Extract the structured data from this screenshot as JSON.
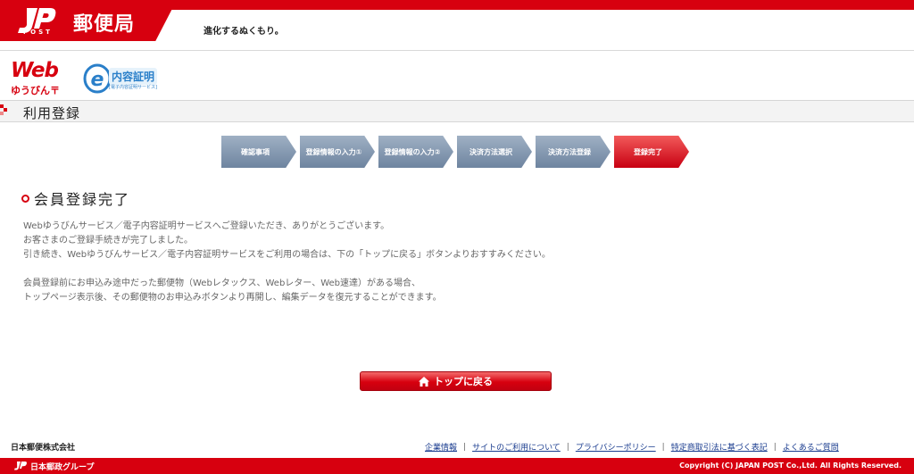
{
  "header": {
    "brand_post": "POST",
    "brand_name": "郵便局",
    "slogan": "進化するぬくもり。",
    "brand_color": "#d7000f"
  },
  "services": {
    "web_word": "Web",
    "web_sub": "ゆうびん〒",
    "e_content": "内容証明",
    "e_sub": "[電子内容証明サービス]"
  },
  "page_title": "利用登録",
  "steps": [
    {
      "label": "確認事項",
      "active": false
    },
    {
      "label": "登録情報の入力①",
      "active": false
    },
    {
      "label": "登録情報の入力②",
      "active": false
    },
    {
      "label": "決済方法選択",
      "active": false
    },
    {
      "label": "決済方法登録",
      "active": false
    },
    {
      "label": "登録完了",
      "active": true
    }
  ],
  "content": {
    "heading": "会員登録完了",
    "para1": [
      "Webゆうびんサービス／電子内容証明サービスへご登録いただき、ありがとうございます。",
      "お客さまのご登録手続きが完了しました。",
      "引き続き、Webゆうびんサービス／電子内容証明サービスをご利用の場合は、下の「トップに戻る」ボタンよりおすすみください。"
    ],
    "para2": [
      "会員登録前にお申込み途中だった郵便物（Webレタックス、Webレター、Web速達）がある場合、",
      "トップページ表示後、その郵便物のお申込みボタンより再開し、編集データを復元することができます。"
    ]
  },
  "button": {
    "label": "トップに戻る",
    "icon": "home-icon"
  },
  "footer": {
    "company": "日本郵便株式会社",
    "links": [
      "企業情報",
      "サイトのご利用について",
      "プライバシーポリシー",
      "特定商取引法に基づく表記",
      "よくあるご質問"
    ],
    "separator": "|",
    "group": "日本郵政グループ",
    "copyright": "Copyright (C) JAPAN POST Co.,Ltd.  All Rights Reserved."
  }
}
